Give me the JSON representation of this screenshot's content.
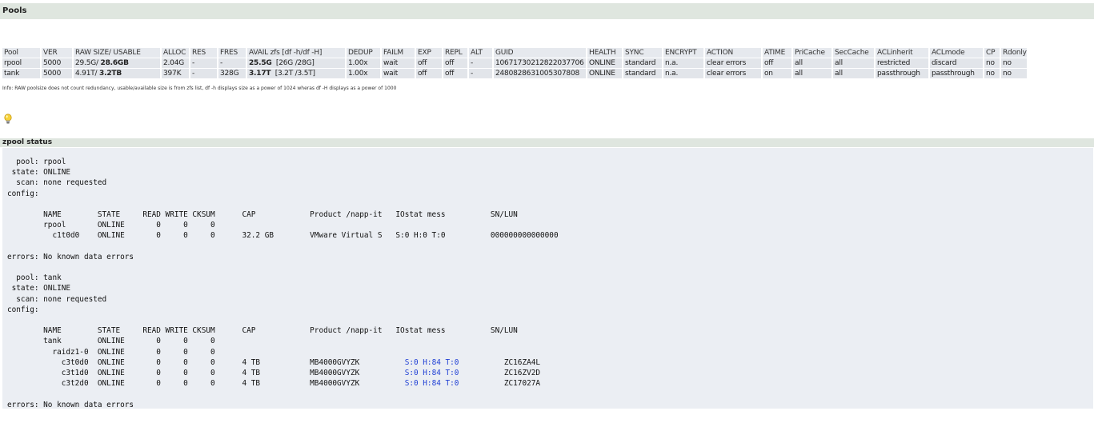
{
  "pools_section": {
    "title": "Pools"
  },
  "pools_table": {
    "headers": [
      "Pool",
      "VER",
      "RAW SIZE/ USABLE",
      "ALLOC",
      "RES",
      "FRES",
      "AVAIL zfs [df -h/df -H]",
      "DEDUP",
      "FAILM",
      "EXP",
      "REPL",
      "ALT",
      "GUID",
      "HEALTH",
      "SYNC",
      "ENCRYPT",
      "ACTION",
      "ATIME",
      "PriCache",
      "SecCache",
      "ACLinherit",
      "ACLmode",
      "CP",
      "Rdonly"
    ],
    "rows": [
      {
        "pool": "rpool",
        "ver": "5000",
        "raw": "29.5G/",
        "usable": "28.6GB",
        "alloc": "2.04G",
        "res": "-",
        "fres": "-",
        "avail": "25.5G",
        "avail_df": "[26G /28G]",
        "dedup": "1.00x",
        "failm": "wait",
        "exp": "off",
        "repl": "off",
        "alt": "-",
        "guid": "10671730212822037706",
        "health": "ONLINE",
        "sync": "standard",
        "encrypt": "n.a.",
        "action": "clear errors",
        "atime": "off",
        "pricache": "all",
        "seccache": "all",
        "aclinherit": "restricted",
        "aclmode": "discard",
        "cp": "no",
        "rdonly": "no"
      },
      {
        "pool": "tank",
        "ver": "5000",
        "raw": "4.91T/",
        "usable": "3.2TB",
        "alloc": "397K",
        "res": "-",
        "fres": "328G",
        "avail": "3.17T",
        "avail_df": "[3.2T /3.5T]",
        "dedup": "1.00x",
        "failm": "wait",
        "exp": "off",
        "repl": "off",
        "alt": "-",
        "guid": "2480828631005307808",
        "health": "ONLINE",
        "sync": "standard",
        "encrypt": "n.a.",
        "action": "clear errors",
        "atime": "on",
        "pricache": "all",
        "seccache": "all",
        "aclinherit": "passthrough",
        "aclmode": "passthrough",
        "cp": "no",
        "rdonly": "no"
      }
    ],
    "info": "Info: RAW poolsize does not count redundancy, usable/available size is from zfs list, df -h displays size as a power of 1024 wheras df -H displays as a power of 1000"
  },
  "icons": {
    "tip": "lightbulb-icon"
  },
  "status_section": {
    "title": "zpool status"
  },
  "zpool_status": {
    "block1": "  pool: rpool\n state: ONLINE\n  scan: none requested\nconfig:\n\n        NAME        STATE     READ WRITE CKSUM      CAP            Product /napp-it   IOstat mess          SN/LUN\n        rpool       ONLINE       0     0     0\n          c1t0d0    ONLINE       0     0     0      32.2 GB        VMware Virtual S   S:0 H:0 T:0          000000000000000\n\nerrors: No known data errors\n\n  pool: tank\n state: ONLINE\n  scan: none requested\nconfig:\n\n        NAME        STATE     READ WRITE CKSUM      CAP            Product /napp-it   IOstat mess          SN/LUN\n        tank        ONLINE       0     0     0\n          raidz1-0  ONLINE       0     0     0\n",
    "disks": [
      {
        "pre": "            c3t0d0  ONLINE       0     0     0      4 TB           MB4000GVYZK          ",
        "iostat": "S:0 H:84 T:0",
        "post": "          ZC16ZA4L"
      },
      {
        "pre": "            c3t1d0  ONLINE       0     0     0      4 TB           MB4000GVYZK          ",
        "iostat": "S:0 H:84 T:0",
        "post": "          ZC16ZV2D"
      },
      {
        "pre": "            c3t2d0  ONLINE       0     0     0      4 TB           MB4000GVYZK          ",
        "iostat": "S:0 H:84 T:0",
        "post": "          ZC17027A"
      }
    ],
    "footer": "\nerrors: No known data errors"
  }
}
